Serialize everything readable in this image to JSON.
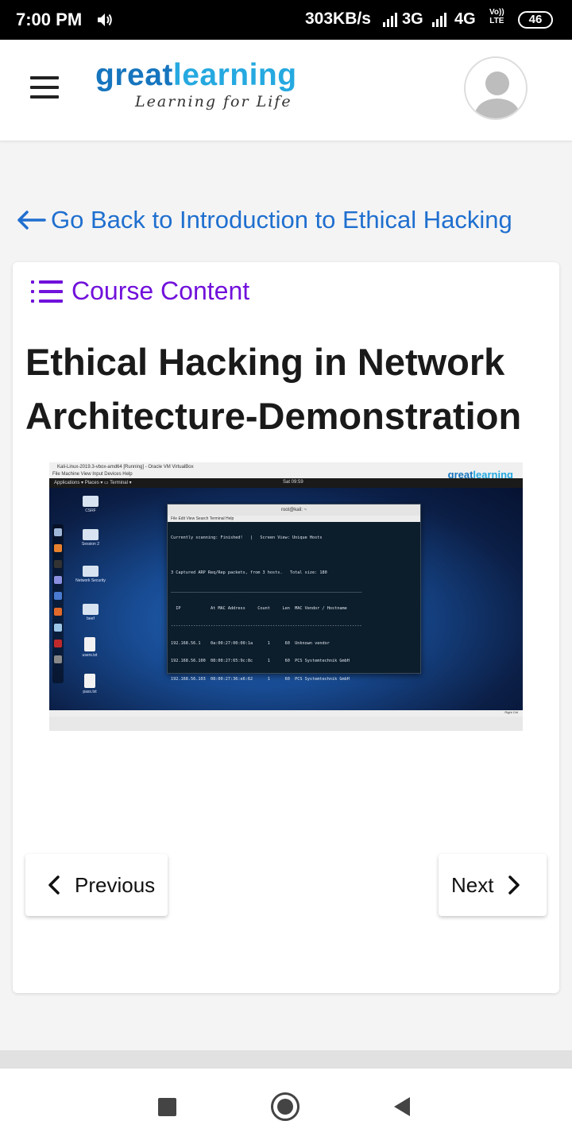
{
  "status_bar": {
    "time": "7:00 PM",
    "speed": "303KB/s",
    "network1": "3G",
    "network2": "4G",
    "volte_top": "Vo))",
    "volte_bottom": "LTE",
    "battery": "46"
  },
  "header": {
    "logo_part1": "great",
    "logo_part2": "learning",
    "tagline": "Learning for Life"
  },
  "back_link": {
    "label": "Go Back to Introduction to Ethical Hacking"
  },
  "course_content": {
    "label": "Course Content"
  },
  "lesson": {
    "title": "Ethical Hacking in Network Architecture-Demonstration"
  },
  "video_thumbnail": {
    "window_title": "Kali-Linux-2019.3-vbox-amd64 [Running] - Oracle VM VirtualBox",
    "window_menu": "File   Machine   View   Input   Devices   Help",
    "watermark_part1": "great",
    "watermark_part2": "learning",
    "top_menu": "Applications ▾     Places ▾     ▭ Terminal ▾",
    "clock": "Sat 09:59",
    "desktop_icons": [
      "CSRF",
      "Session 2",
      "Network Security",
      "beef",
      "users.txt",
      "pass.txt"
    ],
    "terminal_title": "root@kali: ~",
    "terminal_menu": "File  Edit  View  Search  Terminal  Help",
    "terminal_lines": [
      "Currently scanning: Finished!   |   Screen View: Unique Hosts",
      "",
      "3 Captured ARP Req/Rep packets, from 3 hosts.   Total size: 180",
      "_____________________________________________________________________________",
      "  IP            At MAC Address     Count     Len  MAC Vendor / Hostname",
      "-----------------------------------------------------------------------------",
      "192.168.56.1    0a:00:27:00:00:1a      1      60  Unknown vendor",
      "192.168.56.100  08:00:27:65:9c:8c      1      60  PCS Systemtechnik GmbH",
      "192.168.56.103  08:00:27:36:e6:62      1      60  PCS Systemtechnik GmbH"
    ],
    "status_line": "Right Ctrl"
  },
  "navigation": {
    "previous_label": "Previous",
    "next_label": "Next"
  },
  "icons": {
    "menu": "hamburger-icon",
    "avatar": "user-avatar-icon",
    "back": "arrow-left-icon",
    "list": "list-icon",
    "prev": "chevron-left-icon",
    "next": "chevron-right-icon"
  },
  "colors": {
    "link_blue": "#1f6fcf",
    "course_purple": "#7111db",
    "logo_dark": "#1675be",
    "logo_light": "#25a9e0"
  }
}
